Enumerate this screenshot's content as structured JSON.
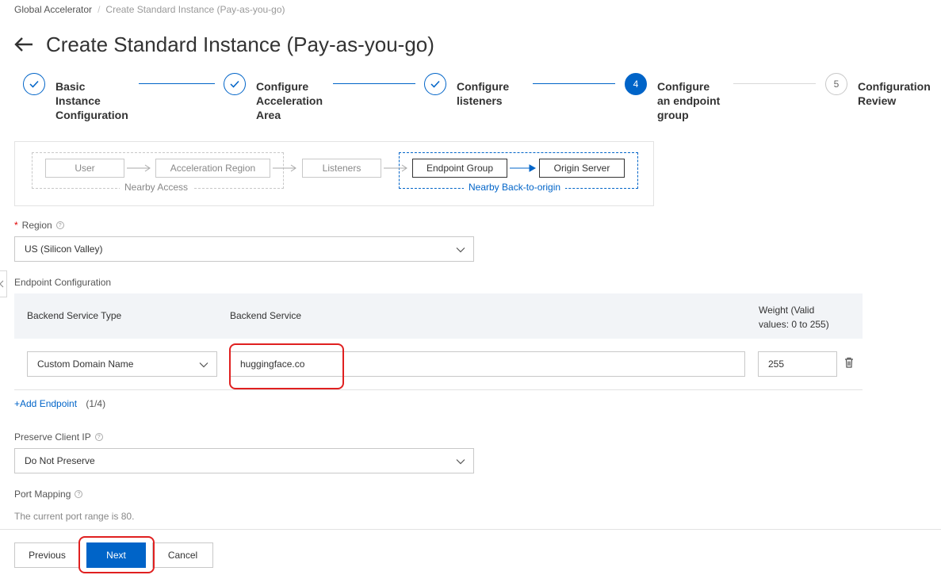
{
  "breadcrumb": {
    "root": "Global Accelerator",
    "separator": "/",
    "current": "Create Standard Instance (Pay-as-you-go)"
  },
  "page": {
    "title": "Create Standard Instance (Pay-as-you-go)"
  },
  "steps": [
    {
      "number": "1",
      "line1": "Basic",
      "line2": "Instance",
      "line3": "Configuration",
      "status": "done"
    },
    {
      "number": "2",
      "line1": "Configure",
      "line2": "Acceleration",
      "line3": "Area",
      "status": "done"
    },
    {
      "number": "3",
      "line1": "Configure",
      "line2": "listeners",
      "line3": "",
      "status": "done"
    },
    {
      "number": "4",
      "line1": "Configure",
      "line2": "an endpoint",
      "line3": "group",
      "status": "active"
    },
    {
      "number": "5",
      "line1": "Configuration",
      "line2": "Review",
      "line3": "",
      "status": "pending"
    }
  ],
  "topology": {
    "user": "User",
    "acceleration_region": "Acceleration Region",
    "listeners": "Listeners",
    "endpoint_group": "Endpoint Group",
    "origin_server": "Origin Server",
    "nearby_access": "Nearby Access",
    "nearby_back_to_origin": "Nearby Back-to-origin"
  },
  "region": {
    "label": "Region",
    "value": "US (Silicon Valley)"
  },
  "endpoint_config": {
    "label": "Endpoint Configuration",
    "headers": {
      "type": "Backend Service Type",
      "service": "Backend Service",
      "weight_line1": "Weight (Valid",
      "weight_line2": "values: 0 to 255)"
    },
    "rows": [
      {
        "type": "Custom Domain Name",
        "service": "huggingface.co",
        "weight": "255"
      }
    ],
    "add_link": "+Add Endpoint",
    "count": "(1/4)"
  },
  "preserve_client_ip": {
    "label": "Preserve Client IP",
    "value": "Do Not Preserve"
  },
  "port_mapping": {
    "label": "Port Mapping",
    "help": "The current port range is 80."
  },
  "footer": {
    "previous": "Previous",
    "next": "Next",
    "cancel": "Cancel"
  },
  "colors": {
    "primary": "#0064c8",
    "highlight": "#e02020",
    "required": "#e00000"
  }
}
